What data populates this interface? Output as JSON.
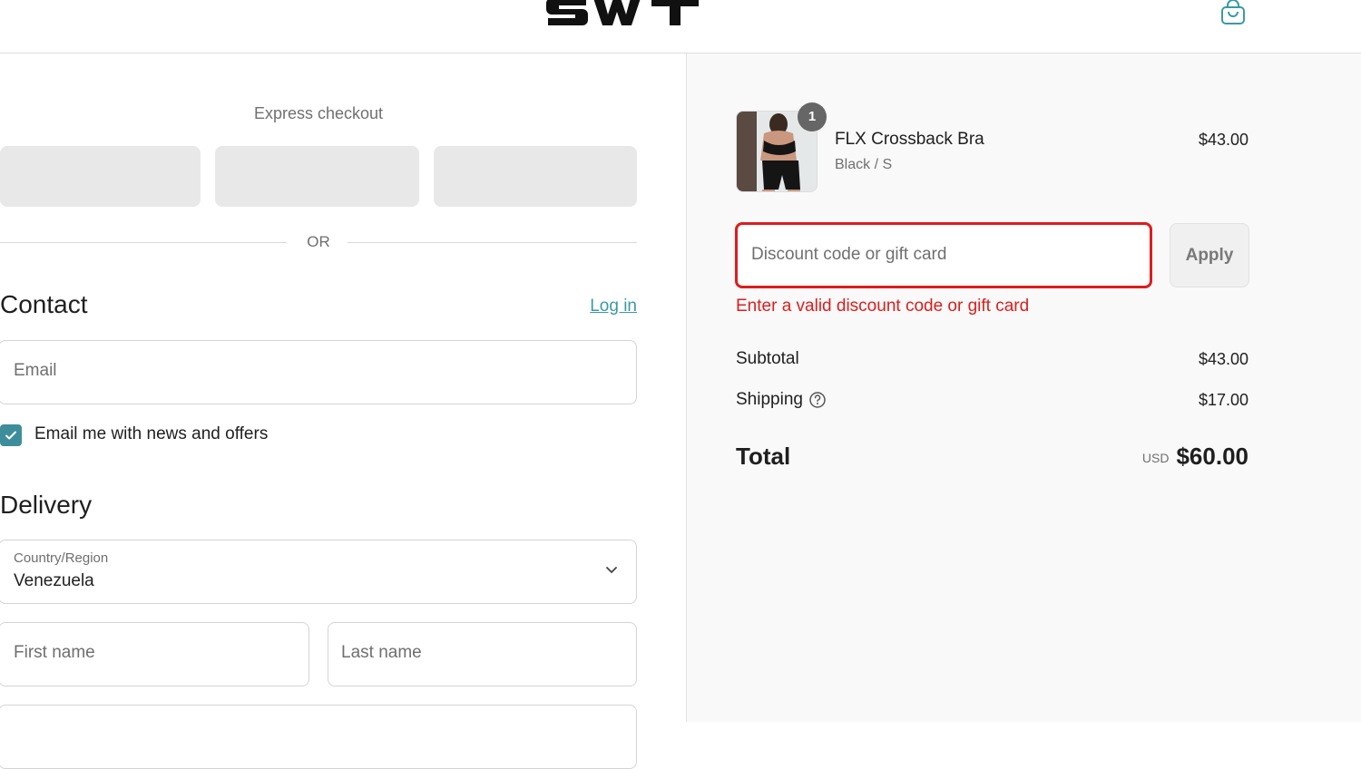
{
  "brand": {
    "logo_text": "SWT"
  },
  "colors": {
    "accent": "#3a9aa6",
    "error": "#dd1d1d",
    "checkbox": "#3d8e9a"
  },
  "icons": {
    "cart": "shopping-bag-icon",
    "checkbox": "checkmark-icon",
    "select": "chevron-down-icon",
    "help": "question-circle-icon"
  },
  "express": {
    "title": "Express checkout",
    "divider": "OR"
  },
  "contact": {
    "title": "Contact",
    "login_link": "Log in",
    "email_placeholder": "Email",
    "newsletter_label": "Email me with news and offers",
    "newsletter_checked": true
  },
  "delivery": {
    "title": "Delivery",
    "country_label": "Country/Region",
    "country_value": "Venezuela",
    "first_name_placeholder": "First name",
    "last_name_placeholder": "Last name"
  },
  "summary": {
    "item": {
      "quantity": "1",
      "name": "FLX Crossback Bra",
      "variant": "Black / S",
      "price": "$43.00"
    },
    "discount_placeholder": "Discount code or gift card",
    "apply_label": "Apply",
    "error_message": "Enter a valid discount code or gift card",
    "subtotal_label": "Subtotal",
    "subtotal_value": "$43.00",
    "shipping_label": "Shipping",
    "shipping_value": "$17.00",
    "total_label": "Total",
    "currency": "USD",
    "total_value": "$60.00"
  }
}
